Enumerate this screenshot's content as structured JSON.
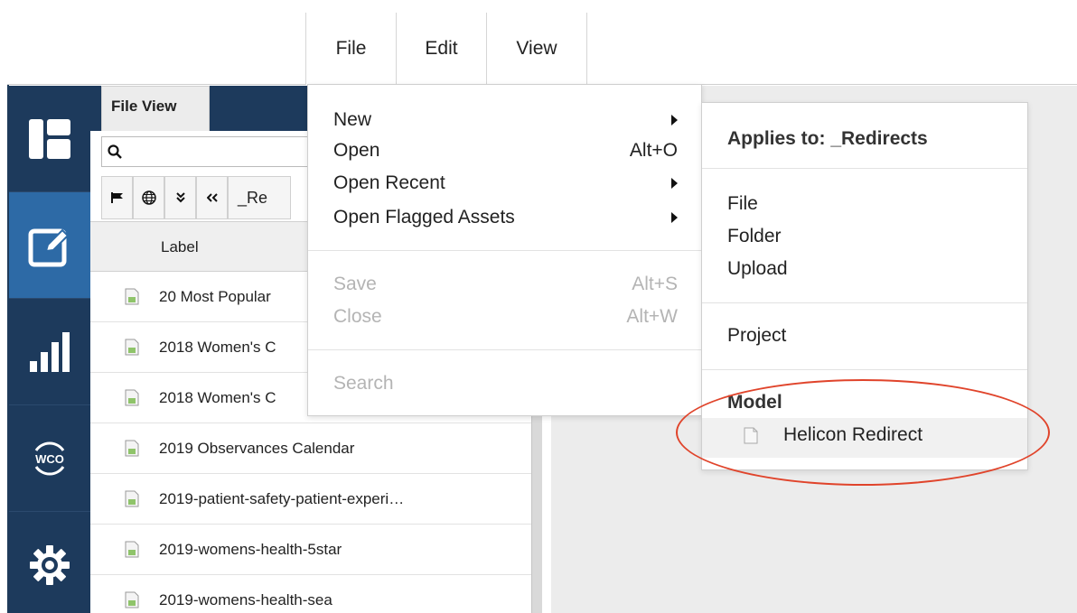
{
  "menubar": {
    "items": [
      {
        "label": "File"
      },
      {
        "label": "Edit"
      },
      {
        "label": "View"
      }
    ]
  },
  "left_nav": {
    "items": [
      {
        "icon": "dashboard-icon"
      },
      {
        "icon": "edit-icon",
        "active": true
      },
      {
        "icon": "bar-chart-icon"
      },
      {
        "icon": "wco-icon",
        "label": "WCO"
      },
      {
        "icon": "gear-icon"
      }
    ]
  },
  "file_view": {
    "tab_label": "File View",
    "search_placeholder": "",
    "toolbar": {
      "breadcrumb": "_Re"
    },
    "column_header": "Label",
    "rows": [
      {
        "label": "20 Most Popular"
      },
      {
        "label": "2018 Women's C"
      },
      {
        "label": "2018 Women's C"
      },
      {
        "label": "2019 Observances Calendar"
      },
      {
        "label": "2019-patient-safety-patient-experi…"
      },
      {
        "label": "2019-womens-health-5star"
      },
      {
        "label": "2019-womens-health-sea"
      }
    ]
  },
  "file_menu": {
    "groups": [
      [
        {
          "label": "New",
          "shortcut": "",
          "submenu": true,
          "enabled": true
        },
        {
          "label": "Open",
          "shortcut": "Alt+O",
          "submenu": false,
          "enabled": true
        },
        {
          "label": "Open Recent",
          "shortcut": "",
          "submenu": true,
          "enabled": true
        },
        {
          "label": "Open Flagged Assets",
          "shortcut": "",
          "submenu": true,
          "enabled": true
        }
      ],
      [
        {
          "label": "Save",
          "shortcut": "Alt+S",
          "submenu": false,
          "enabled": false
        },
        {
          "label": "Close",
          "shortcut": "Alt+W",
          "submenu": false,
          "enabled": false
        }
      ],
      [
        {
          "label": "Search",
          "shortcut": "",
          "submenu": false,
          "enabled": false
        }
      ]
    ]
  },
  "new_submenu": {
    "header": "Applies to: _Redirects",
    "file_items": [
      "File",
      "Folder",
      "Upload"
    ],
    "project_item": "Project",
    "model_header": "Model",
    "model_item": "Helicon Redirect"
  },
  "colors": {
    "nav_bg": "#1d3a5c",
    "nav_active": "#2d6aa6",
    "highlight_oval": "#e0442b"
  }
}
